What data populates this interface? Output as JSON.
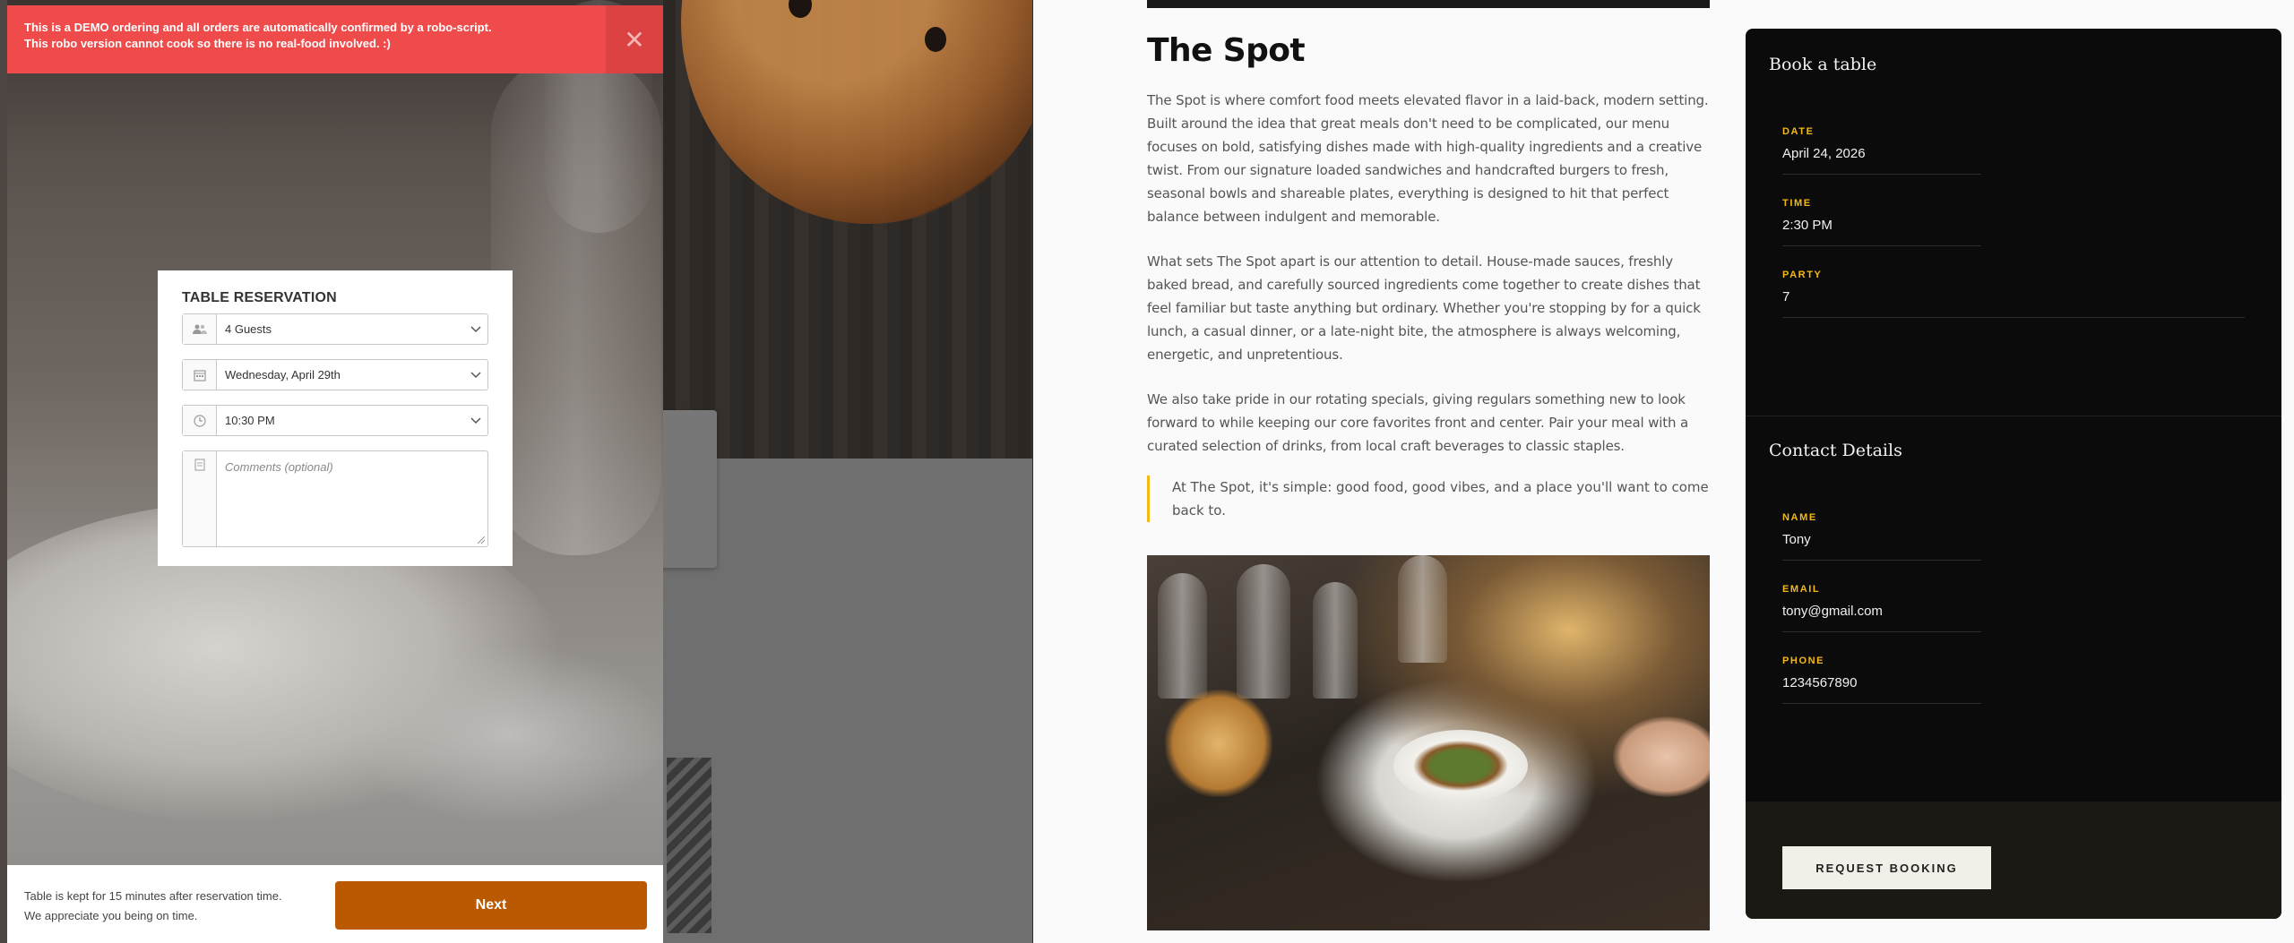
{
  "demo_banner": {
    "line1": "This is a DEMO ordering and all orders are automatically confirmed by a robo-script.",
    "line2": "This robo version cannot cook so there is no real-food involved. :)",
    "close_glyph": "✕"
  },
  "reservation": {
    "title": "TABLE RESERVATION",
    "guests": "4 Guests",
    "date": "Wednesday, April 29th",
    "time": "10:30 PM",
    "comments_placeholder": "Comments (optional)"
  },
  "footer": {
    "note_line1": "Table is kept for 15 minutes after reservation time.",
    "note_line2": "We appreciate you being on time.",
    "next_label": "Next",
    "next_color": "#bb5903"
  },
  "article": {
    "title": "The Spot",
    "paragraphs": [
      "The Spot is where comfort food meets elevated flavor in a laid-back, modern setting. Built around the idea that great meals don't need to be complicated, our menu focuses on bold, satisfying dishes made with high-quality ingredients and a creative twist. From our signature loaded sandwiches and handcrafted burgers to fresh, seasonal bowls and shareable plates, everything is designed to hit that perfect balance between indulgent and memorable.",
      "What sets The Spot apart is our attention to detail. House-made sauces, freshly baked bread, and carefully sourced ingredients come together to create dishes that feel familiar but taste anything but ordinary. Whether you're stopping by for a quick lunch, a casual dinner, or a late-night bite, the atmosphere is always welcoming, energetic, and unpretentious.",
      "We also take pride in our rotating specials, giving regulars something new to look forward to while keeping our core favorites front and center. Pair your meal with a curated selection of drinks, from local craft beverages to classic staples."
    ],
    "quote": "At The Spot, it's simple: good food, good vibes, and a place you'll want to come back to."
  },
  "booking": {
    "title": "Book a table",
    "date_label": "DATE",
    "date_value": "April 24, 2026",
    "time_label": "TIME",
    "time_value": "2:30 PM",
    "party_label": "PARTY",
    "party_value": "7",
    "contact_title": "Contact Details",
    "name_label": "NAME",
    "name_value": "Tony",
    "email_label": "EMAIL",
    "email_value": "tony@gmail.com",
    "phone_label": "PHONE",
    "phone_value": "1234567890",
    "request_label": "REQUEST BOOKING",
    "accent_color": "#f5b915"
  },
  "icons": [
    "guests-icon",
    "calendar-icon",
    "clock-icon",
    "comment-icon",
    "chevron-down-icon",
    "close-icon"
  ]
}
